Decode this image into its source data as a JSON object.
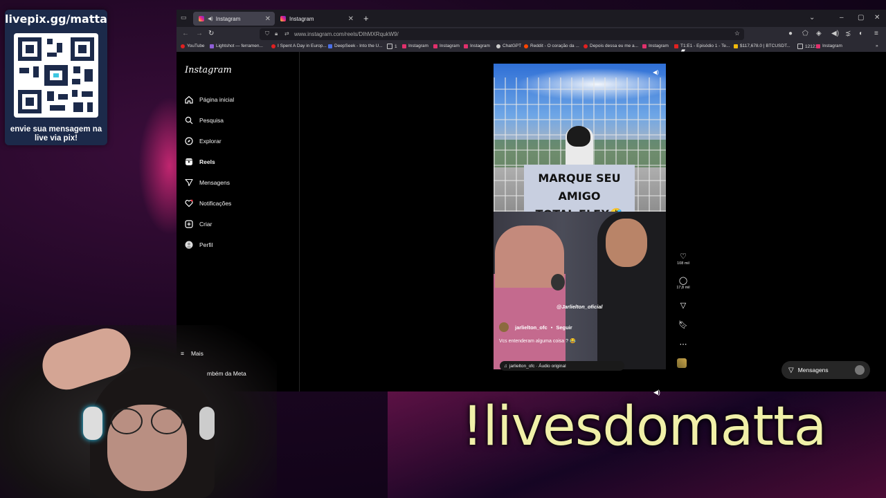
{
  "livepix": {
    "title": "livepix.gg/matta",
    "message": "envie sua mensagem na live via pix!"
  },
  "browser": {
    "tabs": [
      {
        "label": "Instagram",
        "active": true
      },
      {
        "label": "Instagram",
        "active": false
      }
    ],
    "url": "www.instagram.com/reels/DIhMXRqukW9/",
    "bookmarks": [
      "YouTube",
      "Lightshot — ferramen...",
      "I Spent A Day in Europ...",
      "DeepSeek - Into the U...",
      "1",
      "Instagram",
      "Instagram",
      "Instagram",
      "ChatGPT",
      "Reddit - O coração da ...",
      "Depois dessa eu me a...",
      "Instagram",
      "T1:E1 - Episódio 1 - Te...",
      "$117,678.0 | BTCUSDT...",
      "12121",
      "Instagram"
    ]
  },
  "instagram": {
    "logo": "Instagram",
    "sidebar": [
      {
        "label": "Página inicial",
        "icon": "home-icon"
      },
      {
        "label": "Pesquisa",
        "icon": "search-icon"
      },
      {
        "label": "Explorar",
        "icon": "compass-icon"
      },
      {
        "label": "Reels",
        "icon": "reels-icon"
      },
      {
        "label": "Mensagens",
        "icon": "send-icon"
      },
      {
        "label": "Notificações",
        "icon": "heart-icon"
      },
      {
        "label": "Criar",
        "icon": "plus-icon"
      },
      {
        "label": "Perfil",
        "icon": "profile-icon"
      }
    ],
    "more": "Mais",
    "also_from_meta": "mbém da Meta",
    "reel": {
      "sign_line1": "MARQUE SEU AMIGO",
      "sign_line2": "TOTAL FLEX🤣",
      "overlay_tag": "@Jarlielton_oficial",
      "username": "jarlielton_ofc",
      "separator": "•",
      "follow": "Seguir",
      "caption": "Vcs entenderam alguma coisa ? 😂",
      "audio": "jarlielton_ofc · Áudio original"
    },
    "actions": {
      "likes": "108 mil",
      "comments": "17,8 mil"
    },
    "messages_button": "Mensagens"
  },
  "overlay": {
    "command": "!livesdomatta"
  }
}
